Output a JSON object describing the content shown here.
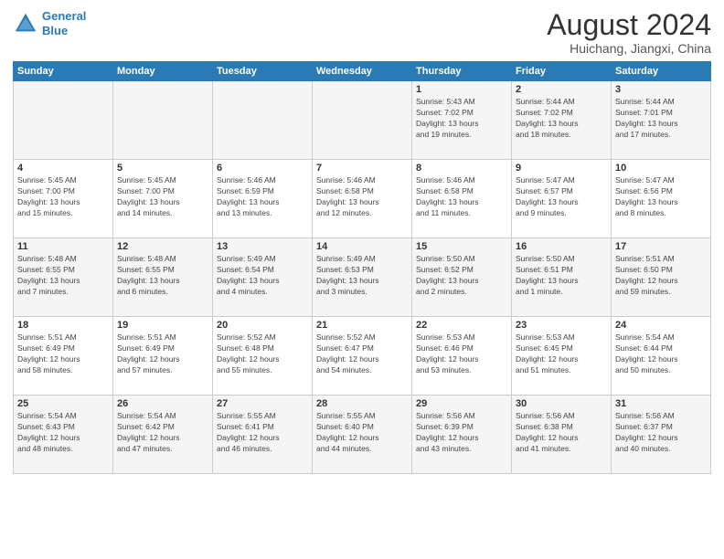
{
  "logo": {
    "line1": "General",
    "line2": "Blue"
  },
  "title": "August 2024",
  "subtitle": "Huichang, Jiangxi, China",
  "days_of_week": [
    "Sunday",
    "Monday",
    "Tuesday",
    "Wednesday",
    "Thursday",
    "Friday",
    "Saturday"
  ],
  "weeks": [
    [
      {
        "day": "",
        "info": ""
      },
      {
        "day": "",
        "info": ""
      },
      {
        "day": "",
        "info": ""
      },
      {
        "day": "",
        "info": ""
      },
      {
        "day": "1",
        "info": "Sunrise: 5:43 AM\nSunset: 7:02 PM\nDaylight: 13 hours\nand 19 minutes."
      },
      {
        "day": "2",
        "info": "Sunrise: 5:44 AM\nSunset: 7:02 PM\nDaylight: 13 hours\nand 18 minutes."
      },
      {
        "day": "3",
        "info": "Sunrise: 5:44 AM\nSunset: 7:01 PM\nDaylight: 13 hours\nand 17 minutes."
      }
    ],
    [
      {
        "day": "4",
        "info": "Sunrise: 5:45 AM\nSunset: 7:00 PM\nDaylight: 13 hours\nand 15 minutes."
      },
      {
        "day": "5",
        "info": "Sunrise: 5:45 AM\nSunset: 7:00 PM\nDaylight: 13 hours\nand 14 minutes."
      },
      {
        "day": "6",
        "info": "Sunrise: 5:46 AM\nSunset: 6:59 PM\nDaylight: 13 hours\nand 13 minutes."
      },
      {
        "day": "7",
        "info": "Sunrise: 5:46 AM\nSunset: 6:58 PM\nDaylight: 13 hours\nand 12 minutes."
      },
      {
        "day": "8",
        "info": "Sunrise: 5:46 AM\nSunset: 6:58 PM\nDaylight: 13 hours\nand 11 minutes."
      },
      {
        "day": "9",
        "info": "Sunrise: 5:47 AM\nSunset: 6:57 PM\nDaylight: 13 hours\nand 9 minutes."
      },
      {
        "day": "10",
        "info": "Sunrise: 5:47 AM\nSunset: 6:56 PM\nDaylight: 13 hours\nand 8 minutes."
      }
    ],
    [
      {
        "day": "11",
        "info": "Sunrise: 5:48 AM\nSunset: 6:55 PM\nDaylight: 13 hours\nand 7 minutes."
      },
      {
        "day": "12",
        "info": "Sunrise: 5:48 AM\nSunset: 6:55 PM\nDaylight: 13 hours\nand 6 minutes."
      },
      {
        "day": "13",
        "info": "Sunrise: 5:49 AM\nSunset: 6:54 PM\nDaylight: 13 hours\nand 4 minutes."
      },
      {
        "day": "14",
        "info": "Sunrise: 5:49 AM\nSunset: 6:53 PM\nDaylight: 13 hours\nand 3 minutes."
      },
      {
        "day": "15",
        "info": "Sunrise: 5:50 AM\nSunset: 6:52 PM\nDaylight: 13 hours\nand 2 minutes."
      },
      {
        "day": "16",
        "info": "Sunrise: 5:50 AM\nSunset: 6:51 PM\nDaylight: 13 hours\nand 1 minute."
      },
      {
        "day": "17",
        "info": "Sunrise: 5:51 AM\nSunset: 6:50 PM\nDaylight: 12 hours\nand 59 minutes."
      }
    ],
    [
      {
        "day": "18",
        "info": "Sunrise: 5:51 AM\nSunset: 6:49 PM\nDaylight: 12 hours\nand 58 minutes."
      },
      {
        "day": "19",
        "info": "Sunrise: 5:51 AM\nSunset: 6:49 PM\nDaylight: 12 hours\nand 57 minutes."
      },
      {
        "day": "20",
        "info": "Sunrise: 5:52 AM\nSunset: 6:48 PM\nDaylight: 12 hours\nand 55 minutes."
      },
      {
        "day": "21",
        "info": "Sunrise: 5:52 AM\nSunset: 6:47 PM\nDaylight: 12 hours\nand 54 minutes."
      },
      {
        "day": "22",
        "info": "Sunrise: 5:53 AM\nSunset: 6:46 PM\nDaylight: 12 hours\nand 53 minutes."
      },
      {
        "day": "23",
        "info": "Sunrise: 5:53 AM\nSunset: 6:45 PM\nDaylight: 12 hours\nand 51 minutes."
      },
      {
        "day": "24",
        "info": "Sunrise: 5:54 AM\nSunset: 6:44 PM\nDaylight: 12 hours\nand 50 minutes."
      }
    ],
    [
      {
        "day": "25",
        "info": "Sunrise: 5:54 AM\nSunset: 6:43 PM\nDaylight: 12 hours\nand 48 minutes."
      },
      {
        "day": "26",
        "info": "Sunrise: 5:54 AM\nSunset: 6:42 PM\nDaylight: 12 hours\nand 47 minutes."
      },
      {
        "day": "27",
        "info": "Sunrise: 5:55 AM\nSunset: 6:41 PM\nDaylight: 12 hours\nand 46 minutes."
      },
      {
        "day": "28",
        "info": "Sunrise: 5:55 AM\nSunset: 6:40 PM\nDaylight: 12 hours\nand 44 minutes."
      },
      {
        "day": "29",
        "info": "Sunrise: 5:56 AM\nSunset: 6:39 PM\nDaylight: 12 hours\nand 43 minutes."
      },
      {
        "day": "30",
        "info": "Sunrise: 5:56 AM\nSunset: 6:38 PM\nDaylight: 12 hours\nand 41 minutes."
      },
      {
        "day": "31",
        "info": "Sunrise: 5:56 AM\nSunset: 6:37 PM\nDaylight: 12 hours\nand 40 minutes."
      }
    ]
  ]
}
